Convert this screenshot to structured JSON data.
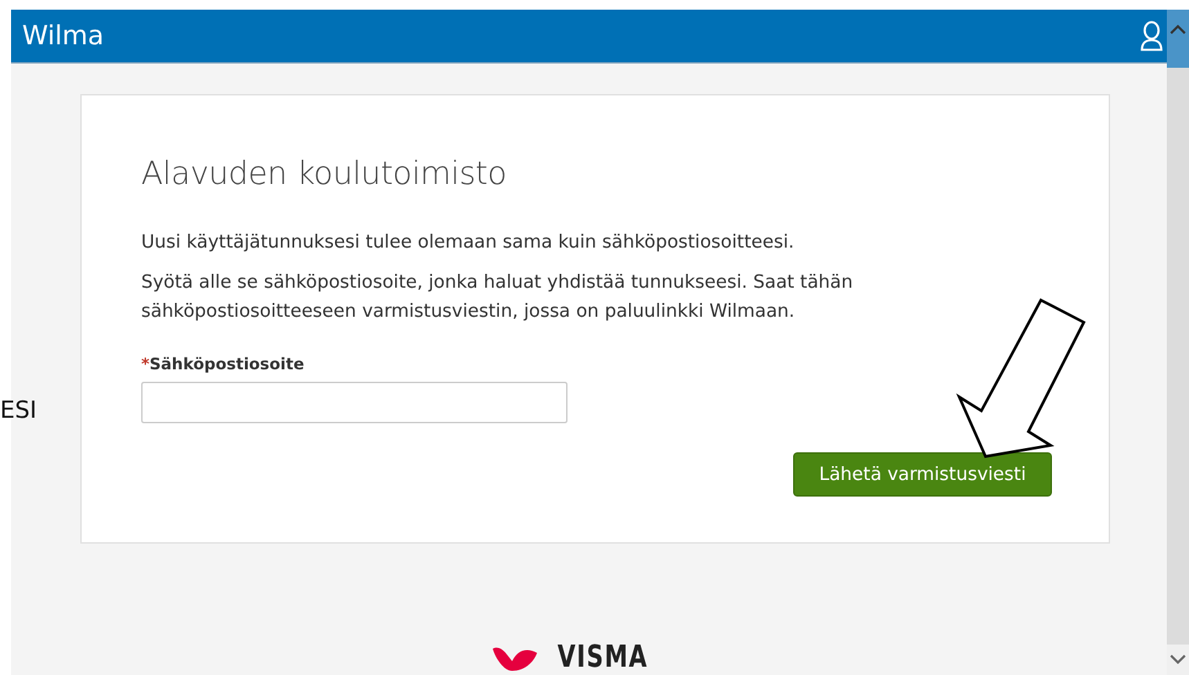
{
  "header": {
    "title": "Wilma"
  },
  "margin_text": "ESI",
  "card": {
    "title": "Alavuden koulutoimisto",
    "paragraphs": [
      "Uusi käyttäjätunnuksesi tulee olemaan sama kuin sähköpostiosoitteesi.",
      "Syötä alle se sähköpostiosoite, jonka haluat yhdistää tunnukseesi. Saat tähän sähköpostiosoitteeseen varmistusviestin, jossa on paluulinkki Wilmaan."
    ],
    "email_field": {
      "required_mark": "*",
      "label": "Sähköpostiosoite"
    },
    "button": "Lähetä varmistusviesti"
  },
  "footer": {
    "logo": "VISMA"
  }
}
